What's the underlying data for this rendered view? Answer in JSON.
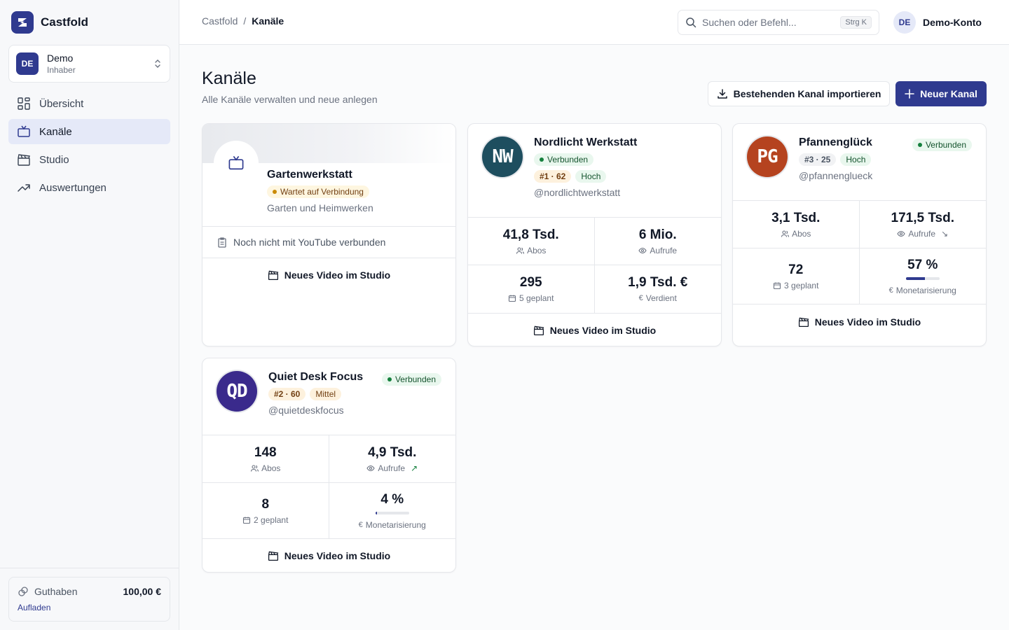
{
  "app": {
    "name": "Castfold"
  },
  "account": {
    "initials": "DE",
    "name": "Demo",
    "role": "Inhaber"
  },
  "nav": [
    {
      "label": "Übersicht",
      "icon": "grid-icon",
      "active": false
    },
    {
      "label": "Kanäle",
      "icon": "tv-icon",
      "active": true
    },
    {
      "label": "Studio",
      "icon": "clapperboard-icon",
      "active": false
    },
    {
      "label": "Auswertungen",
      "icon": "trending-up-icon",
      "active": false
    }
  ],
  "credit": {
    "label": "Guthaben",
    "amount": "100,00 €",
    "link": "Aufladen"
  },
  "breadcrumb": {
    "root": "Castfold",
    "separator": "/",
    "current": "Kanäle"
  },
  "search": {
    "placeholder": "Suchen oder Befehl...",
    "shortcut": "Strg K"
  },
  "user": {
    "initials": "DE",
    "name": "Demo-Konto"
  },
  "page": {
    "title": "Kanäle",
    "subtitle": "Alle Kanäle verwalten und neue anlegen"
  },
  "actions": {
    "import": "Bestehenden Kanal importieren",
    "new": "Neuer Kanal"
  },
  "colors": {
    "accent": "#2f3a8f",
    "ok": "#16a34a",
    "warn": "#ca8a04"
  },
  "studio_label": "Neues Video im Studio",
  "channels": [
    {
      "name": "Gartenwerkstatt",
      "status": "Wartet auf Verbindung",
      "category": "Garten und Heimwerken",
      "notice": "Noch nicht mit YouTube verbunden"
    },
    {
      "name": "Nordlicht Werkstatt",
      "initials": "NW",
      "status": "Verbunden",
      "rank": "#1 · 62",
      "level": "Hoch",
      "handle": "@nordlichtwerkstatt",
      "stats": [
        {
          "value": "41,8 Tsd.",
          "label": "Abos",
          "icon": "users-icon"
        },
        {
          "value": "6 Mio.",
          "label": "Aufrufe",
          "icon": "eye-icon"
        },
        {
          "value": "295",
          "label": "5 geplant",
          "icon": "calendar-icon"
        },
        {
          "value": "1,9 Tsd. €",
          "label": "Verdient",
          "icon": "euro-icon"
        }
      ]
    },
    {
      "name": "Pfannenglück",
      "initials": "PG",
      "status": "Verbunden",
      "rank": "#3 · 25",
      "level": "Hoch",
      "handle": "@pfannenglueck",
      "stats": [
        {
          "value": "3,1 Tsd.",
          "label": "Abos",
          "icon": "users-icon"
        },
        {
          "value": "171,5 Tsd.",
          "label": "Aufrufe",
          "icon": "eye-icon",
          "trend": "↘"
        },
        {
          "value": "72",
          "label": "3 geplant",
          "icon": "calendar-icon"
        },
        {
          "value": "57 %",
          "label": "Monetarisierung",
          "icon": "euro-icon",
          "progress": 0.57
        }
      ]
    },
    {
      "name": "Quiet Desk Focus",
      "initials": "QD",
      "status": "Verbunden",
      "rank": "#2 · 60",
      "level": "Mittel",
      "handle": "@quietdeskfocus",
      "stats": [
        {
          "value": "148",
          "label": "Abos",
          "icon": "users-icon"
        },
        {
          "value": "4,9 Tsd.",
          "label": "Aufrufe",
          "icon": "eye-icon",
          "trend": "↗"
        },
        {
          "value": "8",
          "label": "2 geplant",
          "icon": "calendar-icon"
        },
        {
          "value": "4 %",
          "label": "Monetarisierung",
          "icon": "euro-icon",
          "progress": 0.04
        }
      ]
    }
  ]
}
